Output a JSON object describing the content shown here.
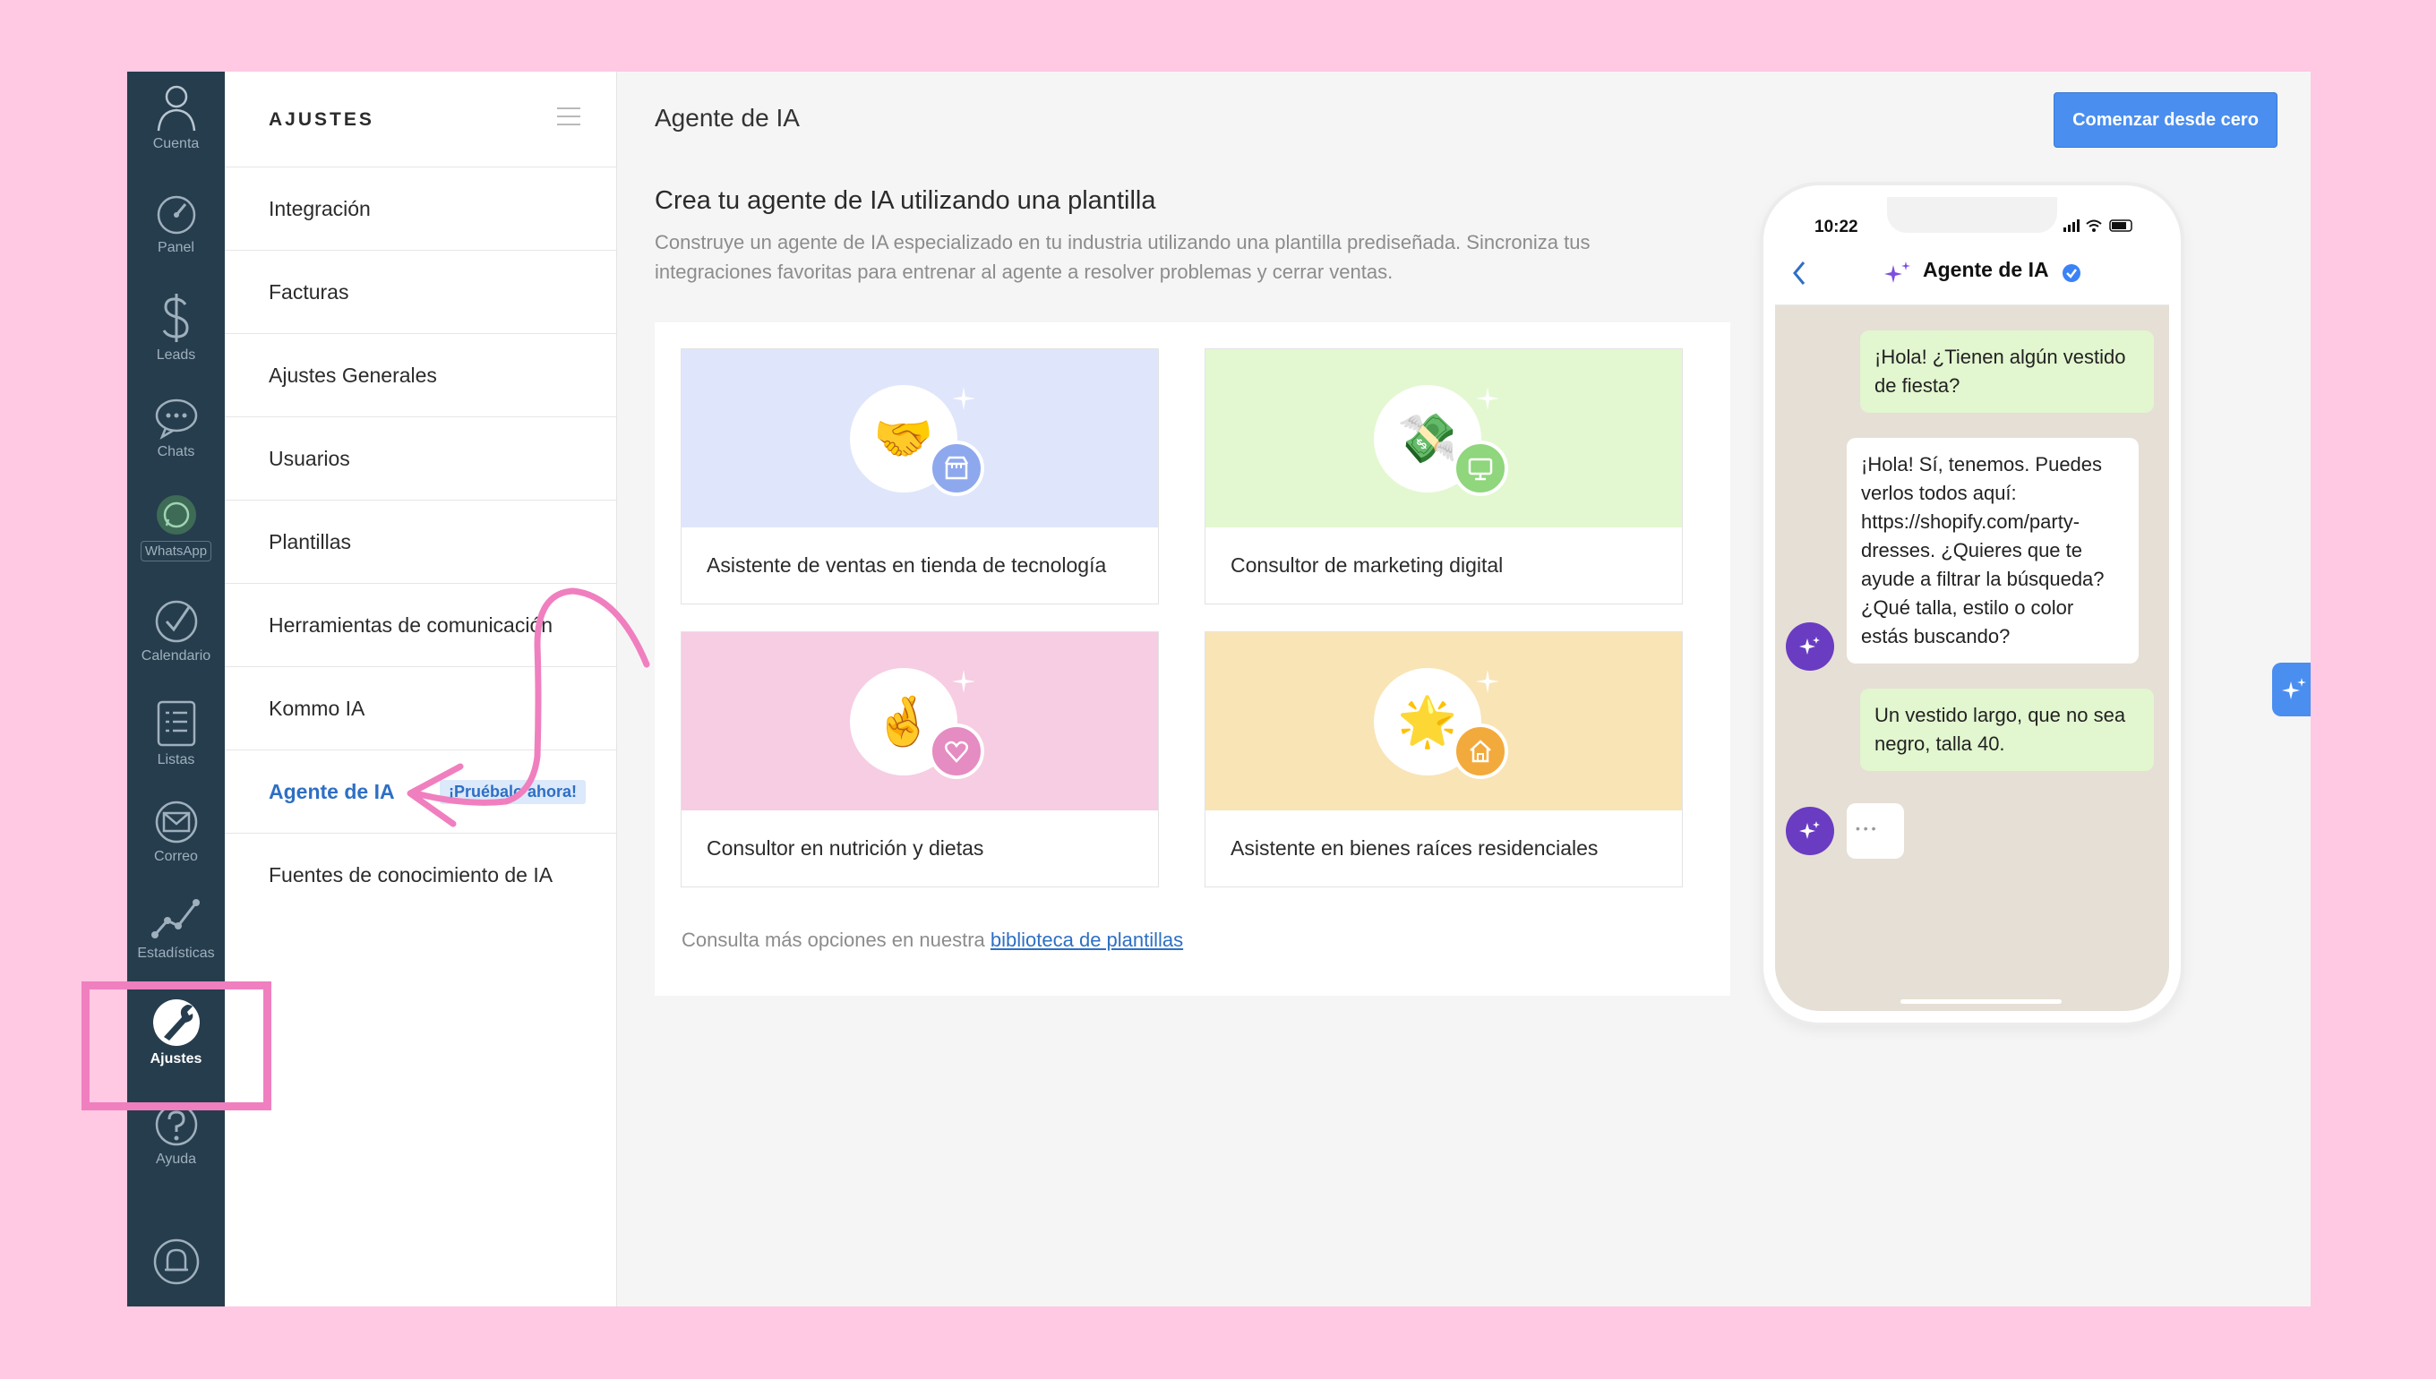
{
  "nav": {
    "items": [
      {
        "id": "cuenta",
        "label": "Cuenta"
      },
      {
        "id": "panel",
        "label": "Panel"
      },
      {
        "id": "leads",
        "label": "Leads"
      },
      {
        "id": "chats",
        "label": "Chats"
      },
      {
        "id": "whatsapp",
        "label": "WhatsApp"
      },
      {
        "id": "calendario",
        "label": "Calendario"
      },
      {
        "id": "listas",
        "label": "Listas"
      },
      {
        "id": "correo",
        "label": "Correo"
      },
      {
        "id": "estadisticas",
        "label": "Estadísticas"
      },
      {
        "id": "ajustes",
        "label": "Ajustes"
      },
      {
        "id": "ayuda",
        "label": "Ayuda"
      }
    ]
  },
  "settings": {
    "title": "AJUSTES",
    "items": [
      {
        "label": "Integración"
      },
      {
        "label": "Facturas"
      },
      {
        "label": "Ajustes Generales"
      },
      {
        "label": "Usuarios"
      },
      {
        "label": "Plantillas"
      },
      {
        "label": "Herramientas de comunicación"
      },
      {
        "label": "Kommo IA"
      },
      {
        "label": "Agente de IA",
        "badge": "¡Pruébalo ahora!"
      },
      {
        "label": "Fuentes de conocimiento de IA"
      }
    ]
  },
  "main": {
    "title": "Agente de IA",
    "primary_button": "Comenzar desde cero",
    "section_title": "Crea tu agente de IA utilizando una plantilla",
    "section_desc": "Construye un agente de IA especializado en tu industria utilizando una plantilla prediseñada. Sincroniza tus integraciones favoritas para entrenar al agente a resolver problemas y cerrar ventas.",
    "cards": [
      {
        "label": "Asistente de ventas en tienda de tecnología",
        "emoji": "🤝",
        "icon": "store-icon",
        "bg": "#dfe6fb",
        "badge_color": "#8ea8ee"
      },
      {
        "label": "Consultor de marketing digital",
        "emoji": "💸",
        "icon": "monitor-icon",
        "bg": "#e3f8d0",
        "badge_color": "#8fd67c"
      },
      {
        "label": "Consultor en nutrición y dietas",
        "emoji": "🤞",
        "icon": "heart-icon",
        "bg": "#f6cde2",
        "badge_color": "#e58cc2"
      },
      {
        "label": "Asistente en bienes raíces residenciales",
        "emoji": "🌟",
        "icon": "house-icon",
        "bg": "#f9e4b6",
        "badge_color": "#f3aa3c"
      }
    ],
    "more_prefix": "Consulta más opciones en nuestra",
    "more_link": "biblioteca de plantillas"
  },
  "phone": {
    "time": "10:22",
    "chat_title": "Agente de IA",
    "messages": [
      {
        "from": "user",
        "text": "¡Hola! ¿Tienen algún vestido de fiesta?"
      },
      {
        "from": "agent",
        "text": "¡Hola! Sí, tenemos. Puedes verlos todos aquí: https://shopify.com/party-dresses. ¿Quieres que te ayude a filtrar la búsqueda? ¿Qué talla, estilo o color estás buscando?"
      },
      {
        "from": "user",
        "text": "Un vestido largo, que no sea negro, talla 40."
      },
      {
        "from": "agent",
        "text": "• • •"
      }
    ]
  },
  "colors": {
    "background": "#ffc8e3",
    "accent": "#4a8ef0",
    "nav_bg": "#263d4e",
    "highlight": "#f07fbf"
  }
}
